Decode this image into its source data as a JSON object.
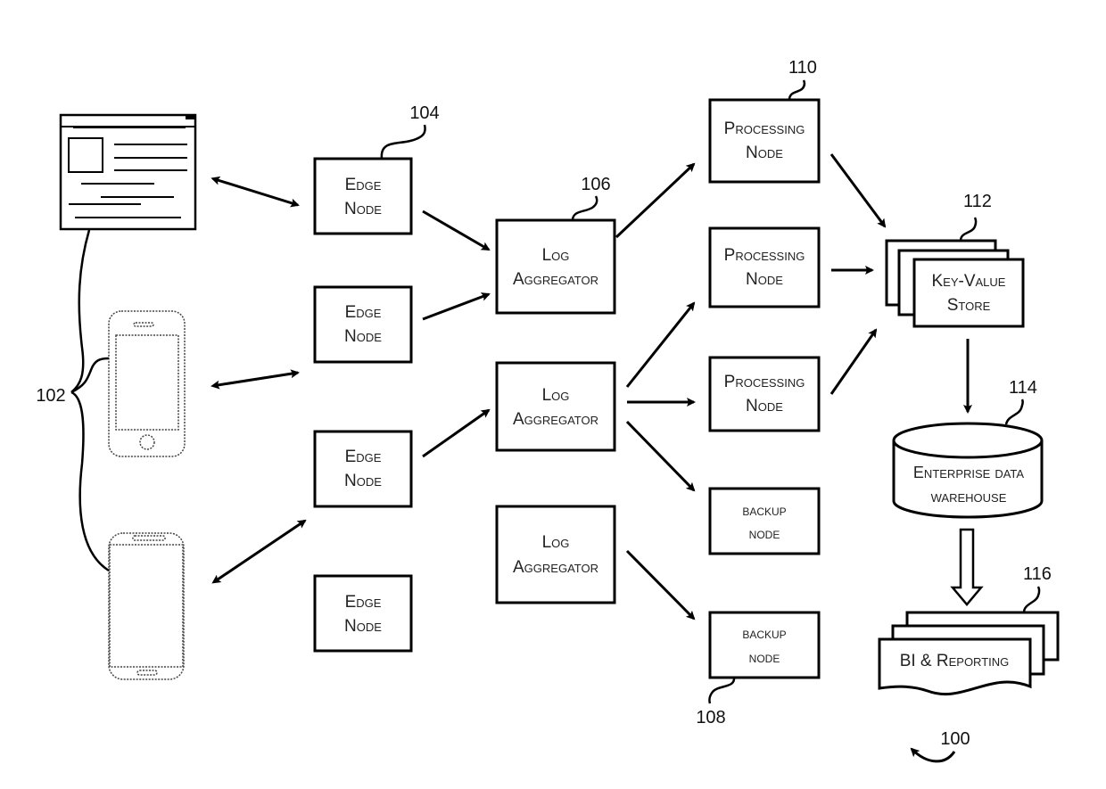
{
  "figure": {
    "ref": "100",
    "clients": {
      "ref": "102",
      "items": [
        "web-browser",
        "iphone",
        "android-phone"
      ]
    },
    "edge_nodes": {
      "ref": "104",
      "items": [
        {
          "line1": "Edge",
          "line2": "Node"
        },
        {
          "line1": "Edge",
          "line2": "Node"
        },
        {
          "line1": "Edge",
          "line2": "Node"
        },
        {
          "line1": "Edge",
          "line2": "Node"
        }
      ]
    },
    "log_aggregators": {
      "ref": "106",
      "items": [
        {
          "line1": "Log",
          "line2": "Aggregator"
        },
        {
          "line1": "Log",
          "line2": "Aggregator"
        },
        {
          "line1": "Log",
          "line2": "Aggregator"
        }
      ]
    },
    "processing_nodes": {
      "ref": "110",
      "items": [
        {
          "line1": "Processing",
          "line2": "Node"
        },
        {
          "line1": "Processing",
          "line2": "Node"
        },
        {
          "line1": "Processing",
          "line2": "Node"
        }
      ]
    },
    "backup_nodes": {
      "ref": "108",
      "items": [
        {
          "line1": "backup",
          "line2": "node"
        },
        {
          "line1": "backup",
          "line2": "node"
        }
      ]
    },
    "key_value_store": {
      "ref": "112",
      "line1": "Key-Value",
      "line2": "Store"
    },
    "data_warehouse": {
      "ref": "114",
      "line1": "Enterprise data",
      "line2": "warehouse"
    },
    "bi_reporting": {
      "ref": "116",
      "label": "BI & Reporting"
    }
  }
}
